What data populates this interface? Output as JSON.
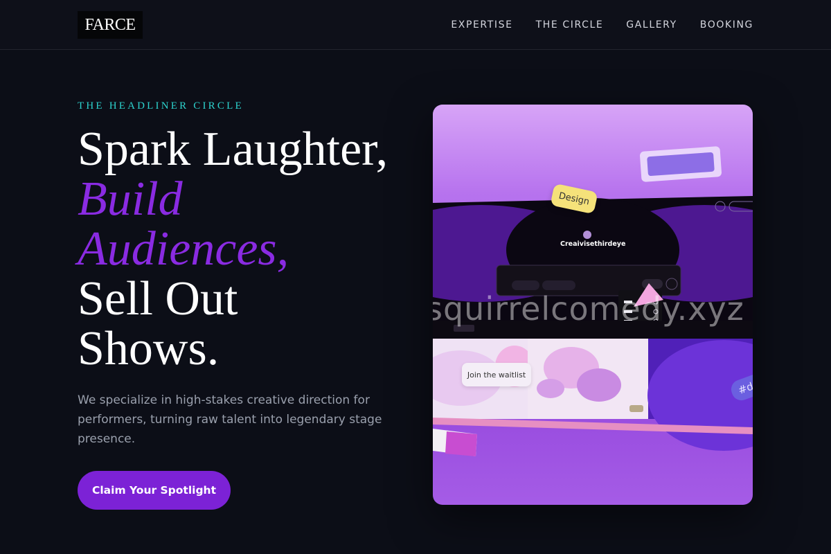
{
  "brand": {
    "logo_text": "FARCE"
  },
  "nav": {
    "links": [
      "EXPERTISE",
      "THE CIRCLE",
      "GALLERY",
      "BOOKING"
    ]
  },
  "hero": {
    "eyebrow": "THE HEADLINER CIRCLE",
    "headline": {
      "line1": "Spark Laughter,",
      "line2": "Build",
      "line3": "Audiences,",
      "line4": "Sell Out",
      "line5": "Shows."
    },
    "subtext": "We specialize in high-stakes creative direction for performers, turning raw talent into legendary stage presence.",
    "cta_label": "Claim Your Spotlight"
  },
  "showcase": {
    "design_tag": "Design",
    "brand_mark": "Creaivisethirdeye",
    "waitlist_label": "Join the waitlist",
    "watermark": "squirrelcomedy.xyz",
    "hashtag": "#de"
  },
  "colors": {
    "background": "#0c0e17",
    "accent_purple": "#8a2be2",
    "eyebrow_teal": "#2dd4cf",
    "cta_purple": "#7c22d6"
  }
}
